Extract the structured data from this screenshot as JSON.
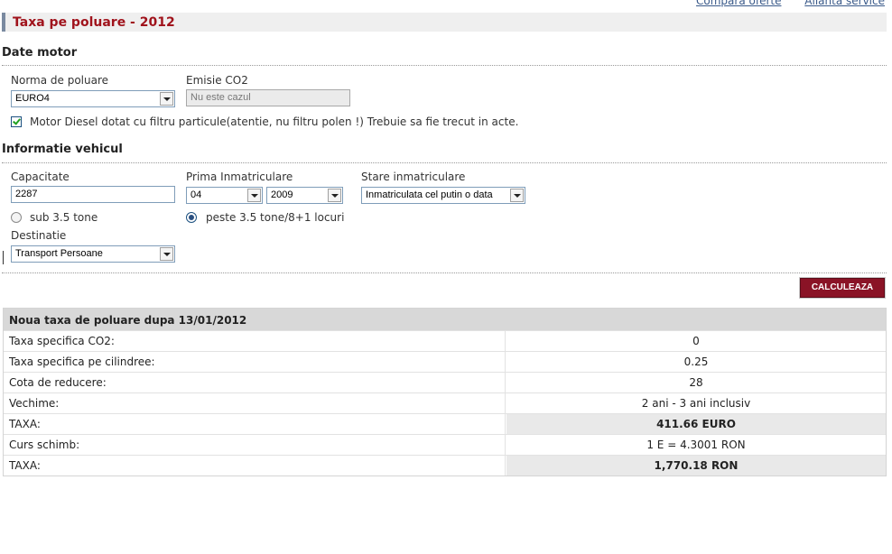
{
  "top_links": [
    "Compara oferte",
    "Alianta service"
  ],
  "page_title": "Taxa pe poluare - 2012",
  "sections": {
    "motor": "Date motor",
    "vehicle": "Informatie vehicul"
  },
  "motor": {
    "norm_label": "Norma de poluare",
    "norm_value": "EURO4",
    "co2_label": "Emisie CO2",
    "co2_placeholder": "Nu este cazul",
    "diesel_filter_checked": true,
    "diesel_filter_label": "Motor Diesel dotat cu filtru particule(atentie, nu filtru polen !) Trebuie sa fie trecut in acte."
  },
  "vehicle": {
    "capacity_label": "Capacitate",
    "capacity_value": "2287",
    "first_reg_label": "Prima Inmatriculare",
    "first_reg_month": "04",
    "first_reg_year": "2009",
    "reg_state_label": "Stare inmatriculare",
    "reg_state_value": "Inmatriculata cel putin o data",
    "weight_under_label": "sub 3.5 tone",
    "weight_over_label": "peste 3.5 tone/8+1 locuri",
    "weight_selected": "peste",
    "destination_label": "Destinatie",
    "destination_value": "Transport Persoane"
  },
  "calculate_button": "CALCULEAZA",
  "results": {
    "header": "Noua taxa de poluare dupa 13/01/2012",
    "rows": [
      {
        "label": "Taxa specifica CO2:",
        "value": "0",
        "highlight": false
      },
      {
        "label": "Taxa specifica pe cilindree:",
        "value": "0.25",
        "highlight": false
      },
      {
        "label": "Cota de reducere:",
        "value": "28",
        "highlight": false
      },
      {
        "label": "Vechime:",
        "value": "2 ani - 3 ani inclusiv",
        "highlight": false
      },
      {
        "label": "TAXA:",
        "value": "411.66 EURO",
        "highlight": true
      },
      {
        "label": "Curs schimb:",
        "value": "1 E = 4.3001 RON",
        "highlight": false
      },
      {
        "label": "TAXA:",
        "value": "1,770.18 RON",
        "highlight": true
      }
    ]
  },
  "colors": {
    "title": "#a0131c",
    "button": "#8a1326",
    "header_bg": "#d8d8d8"
  }
}
